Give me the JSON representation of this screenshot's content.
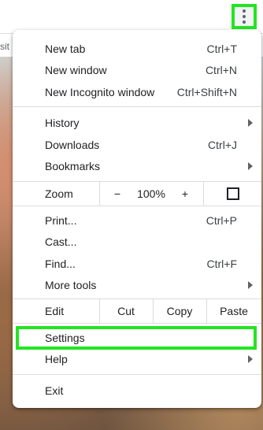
{
  "browser": {
    "background_tab_text": "sit",
    "menu_button_icon": "vertical-ellipsis-icon"
  },
  "menu": {
    "new_tab": {
      "label": "New tab",
      "shortcut": "Ctrl+T"
    },
    "new_window": {
      "label": "New window",
      "shortcut": "Ctrl+N"
    },
    "new_incognito": {
      "label": "New Incognito window",
      "shortcut": "Ctrl+Shift+N"
    },
    "history": {
      "label": "History"
    },
    "downloads": {
      "label": "Downloads",
      "shortcut": "Ctrl+J"
    },
    "bookmarks": {
      "label": "Bookmarks"
    },
    "zoom": {
      "label": "Zoom",
      "minus": "−",
      "value": "100%",
      "plus": "+",
      "fullscreen_icon": "fullscreen-icon"
    },
    "print": {
      "label": "Print...",
      "shortcut": "Ctrl+P"
    },
    "cast": {
      "label": "Cast..."
    },
    "find": {
      "label": "Find...",
      "shortcut": "Ctrl+F"
    },
    "more_tools": {
      "label": "More tools"
    },
    "edit": {
      "label": "Edit",
      "cut": "Cut",
      "copy": "Copy",
      "paste": "Paste"
    },
    "settings": {
      "label": "Settings"
    },
    "help": {
      "label": "Help"
    },
    "exit": {
      "label": "Exit"
    }
  },
  "colors": {
    "highlight": "#22e522",
    "separator": "#dadce0"
  }
}
